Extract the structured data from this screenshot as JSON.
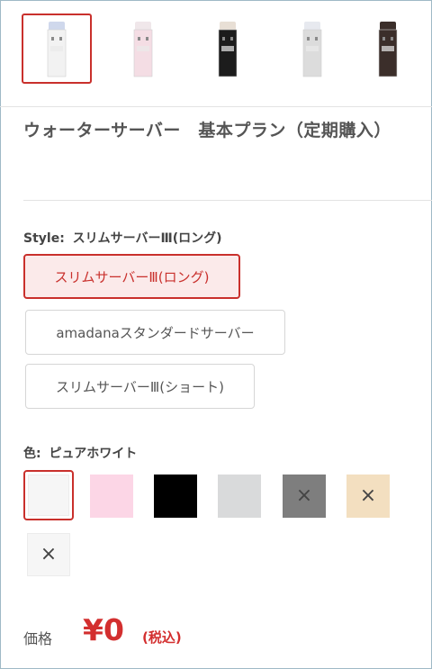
{
  "thumbnails": [
    {
      "name": "server-white",
      "body": "#f2f2f2",
      "top": "#cfd8ec",
      "selected": true
    },
    {
      "name": "server-pink",
      "body": "#f4dde4",
      "top": "#f0e7ea",
      "selected": false
    },
    {
      "name": "server-black",
      "body": "#1c1c1c",
      "top": "#e8dfd5",
      "selected": false
    },
    {
      "name": "server-gray",
      "body": "#dcdcdc",
      "top": "#e7e9ef",
      "selected": false
    },
    {
      "name": "server-brown",
      "body": "#3b2e2a",
      "top": "#3b2e2a",
      "selected": false
    }
  ],
  "product": {
    "title": "ウォーターサーバー　基本プラン（定期購入）"
  },
  "style_option": {
    "label": "Style:",
    "selected_value": "スリムサーバーⅢ(ロング)",
    "options": [
      {
        "label": "スリムサーバーⅢ(ロング)",
        "selected": true
      },
      {
        "label": "amadanaスタンダードサーバー",
        "selected": false
      },
      {
        "label": "スリムサーバーⅢ(ショート)",
        "selected": false
      }
    ]
  },
  "color_option": {
    "label": "色:",
    "selected_value": "ピュアホワイト",
    "swatches": [
      {
        "color": "#f6f6f6",
        "unavailable": false,
        "selected": true
      },
      {
        "color": "#fcd6e6",
        "unavailable": false,
        "selected": false
      },
      {
        "color": "#000000",
        "unavailable": false,
        "selected": false
      },
      {
        "color": "#d9dadb",
        "unavailable": false,
        "selected": false
      },
      {
        "color": "#7e7e7e",
        "unavailable": true,
        "selected": false
      },
      {
        "color": "#f3dfc0",
        "unavailable": true,
        "selected": false
      },
      {
        "color": "#f6f6f6",
        "unavailable": true,
        "selected": false
      }
    ],
    "unavailable_mark": "×"
  },
  "price": {
    "label": "価格",
    "value": "¥0",
    "tax_note": "(税込)"
  },
  "colors": {
    "accent": "#c9302c",
    "price": "#d32f2f"
  }
}
